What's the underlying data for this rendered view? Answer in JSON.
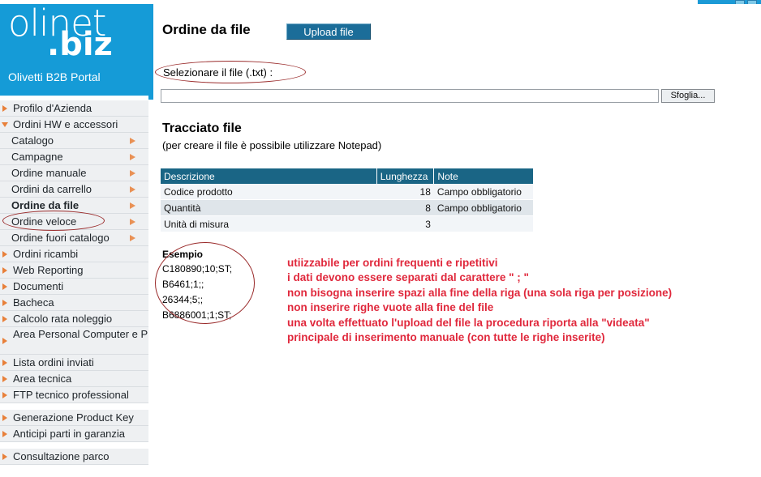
{
  "window": {
    "minimize_label": "",
    "close_label": ""
  },
  "brand": {
    "logo_part1": "oli",
    "logo_part2": "net",
    "logo_suffix": ".biz",
    "tagline": "Olivetti B2B Portal",
    "brand_color": "#159bd7"
  },
  "sidebar": {
    "items": [
      {
        "label": "Profilo d'Azienda",
        "icon": "arrow-right-bullet-icon",
        "level": "top",
        "expanded": false,
        "submenu_arrow": false,
        "current": false
      },
      {
        "label": "Ordini HW e accessori",
        "icon": "arrow-down-bullet-icon",
        "level": "top",
        "expanded": true,
        "submenu_arrow": false,
        "current": false
      },
      {
        "label": "Catalogo",
        "icon": "none",
        "level": "sub",
        "submenu_arrow": true,
        "current": false
      },
      {
        "label": "Campagne",
        "icon": "none",
        "level": "sub",
        "submenu_arrow": true,
        "current": false
      },
      {
        "label": "Ordine manuale",
        "icon": "none",
        "level": "sub",
        "submenu_arrow": true,
        "current": false
      },
      {
        "label": "Ordini da carrello",
        "icon": "none",
        "level": "sub",
        "submenu_arrow": true,
        "current": false
      },
      {
        "label": "Ordine da file",
        "icon": "none",
        "level": "sub",
        "submenu_arrow": true,
        "current": true
      },
      {
        "label": "Ordine veloce",
        "icon": "none",
        "level": "sub",
        "submenu_arrow": true,
        "current": false
      },
      {
        "label": "Ordine fuori catalogo",
        "icon": "none",
        "level": "sub",
        "submenu_arrow": true,
        "current": false
      },
      {
        "label": "Ordini ricambi",
        "icon": "arrow-right-bullet-icon",
        "level": "top",
        "submenu_arrow": false,
        "current": false
      },
      {
        "label": "Web Reporting",
        "icon": "arrow-right-bullet-icon",
        "level": "top",
        "submenu_arrow": false,
        "current": false
      },
      {
        "label": "Documenti",
        "icon": "arrow-right-bullet-icon",
        "level": "top",
        "submenu_arrow": false,
        "current": false
      },
      {
        "label": "Bacheca",
        "icon": "arrow-right-bullet-icon",
        "level": "top",
        "submenu_arrow": false,
        "current": false
      },
      {
        "label": "Calcolo rata noleggio",
        "icon": "arrow-right-bullet-icon",
        "level": "top",
        "submenu_arrow": false,
        "current": false
      },
      {
        "label": "Area Personal Computer e Prodotti Power UPS",
        "icon": "arrow-right-bullet-icon",
        "level": "top-tall",
        "submenu_arrow": false,
        "current": false
      },
      {
        "label": "Lista ordini inviati",
        "icon": "arrow-right-bullet-icon",
        "level": "top",
        "submenu_arrow": false,
        "current": false
      },
      {
        "label": "Area tecnica",
        "icon": "arrow-right-bullet-icon",
        "level": "top",
        "submenu_arrow": false,
        "current": false
      },
      {
        "label": "FTP tecnico professional",
        "icon": "arrow-right-bullet-icon",
        "level": "top",
        "submenu_arrow": false,
        "current": false
      },
      {
        "label": "Generazione Product Key",
        "icon": "arrow-right-bullet-icon",
        "level": "top",
        "gap_before": true,
        "submenu_arrow": false,
        "current": false
      },
      {
        "label": "Anticipi parti in garanzia",
        "icon": "arrow-right-bullet-icon",
        "level": "top",
        "submenu_arrow": false,
        "current": false
      },
      {
        "label": "Consultazione parco",
        "icon": "arrow-right-bullet-icon",
        "level": "top",
        "gap_before": true,
        "submenu_arrow": false,
        "current": false
      }
    ]
  },
  "main": {
    "page_title": "Ordine da file",
    "upload_button": "Upload file",
    "select_file_label": "Selezionare il file (.txt) :",
    "file_input_value": "",
    "file_input_placeholder": "",
    "browse_button": "Sfoglia...",
    "section_title": "Tracciato file",
    "section_note": "(per creare il file è possibile utilizzare Notepad)",
    "table": {
      "headers": [
        "Descrizione",
        "Lunghezza",
        "Note"
      ],
      "rows": [
        [
          "Codice prodotto",
          "18",
          "Campo obbligatorio"
        ],
        [
          "Quantità",
          "8",
          "Campo obbligatorio"
        ],
        [
          "Unità di misura",
          "3",
          ""
        ]
      ]
    },
    "example": {
      "title": "Esempio",
      "lines": [
        "C180890;10;ST;",
        "B6461;1;;",
        "26344;5;;",
        "B6886001;1;ST;"
      ]
    },
    "annotations": {
      "color": "#e0283c",
      "lines": [
        "utiizzabile per ordini frequenti e ripetitivi",
        "i dati devono essere separati dal carattere \" ;  \"",
        "non bisogna inserire spazi alla fine della riga  (una sola riga per posizione)",
        "non inserire righe vuote alla fine del file",
        "una volta effettuato l'upload del file la procedura riporta alla \"videata\"",
        "principale di inserimento manuale (con tutte le righe inserite)"
      ]
    },
    "highlight_color": "#9a2b2b"
  }
}
